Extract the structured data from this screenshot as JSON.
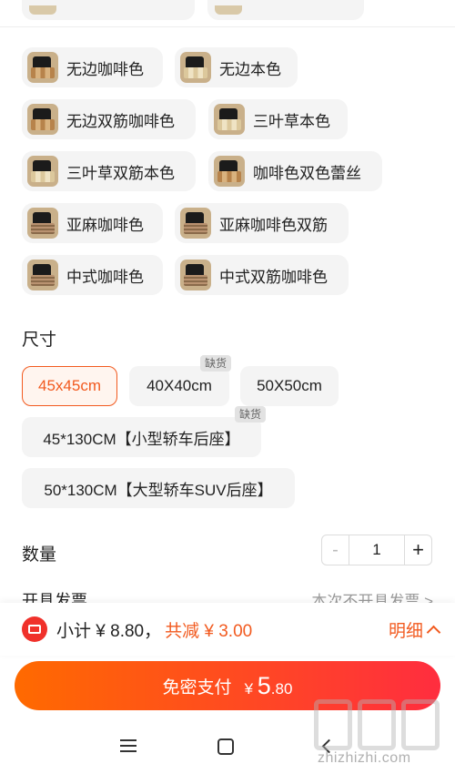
{
  "colors": {
    "accent": "#f25a1f",
    "pay_gradient_start": "#ff6a00",
    "pay_gradient_end": "#ff2d3f",
    "chip_bg": "#f4f4f4",
    "text": "#222222",
    "muted": "#999999"
  },
  "color_options": [
    {
      "label": "无边咖啡色",
      "icon": "dark-coffee-swatch"
    },
    {
      "label": "无边本色",
      "icon": "natural-swatch"
    },
    {
      "label": "无边双筋咖啡色",
      "icon": "dark-coffee-swatch"
    },
    {
      "label": "三叶草本色",
      "icon": "natural-swatch"
    },
    {
      "label": "三叶草双筋本色",
      "icon": "natural-swatch"
    },
    {
      "label": "咖啡色双色蕾丝",
      "icon": "dark-coffee-swatch"
    },
    {
      "label": "亚麻咖啡色",
      "icon": "linen-swatch"
    },
    {
      "label": "亚麻咖啡色双筋",
      "icon": "linen-swatch"
    },
    {
      "label": "中式咖啡色",
      "icon": "linen-swatch"
    },
    {
      "label": "中式双筋咖啡色",
      "icon": "linen-swatch"
    }
  ],
  "size": {
    "title": "尺寸",
    "options": [
      {
        "label": "45x45cm",
        "selected": true,
        "out_of_stock": false
      },
      {
        "label": "40X40cm",
        "selected": false,
        "out_of_stock": true
      },
      {
        "label": "50X50cm",
        "selected": false,
        "out_of_stock": false
      },
      {
        "label": "45*130CM【小型轿车后座】",
        "selected": false,
        "out_of_stock": true
      },
      {
        "label": "50*130CM【大型轿车SUV后座】",
        "selected": false,
        "out_of_stock": false
      }
    ],
    "out_of_stock_label": "缺货"
  },
  "quantity": {
    "title": "数量",
    "minus": "-",
    "value": "1",
    "plus": "+"
  },
  "invoice": {
    "title": "开具发票",
    "value": "本次不开具发票 >"
  },
  "summary": {
    "subtotal": "小计 ¥ 8.80，",
    "discount": "共减 ¥ 3.00",
    "detail_label": "明细"
  },
  "pay": {
    "label": "免密支付",
    "currency": "¥",
    "amount_main": "5",
    "amount_decimal": ".80"
  },
  "watermark": {
    "text": "zhizhizhi.com"
  }
}
